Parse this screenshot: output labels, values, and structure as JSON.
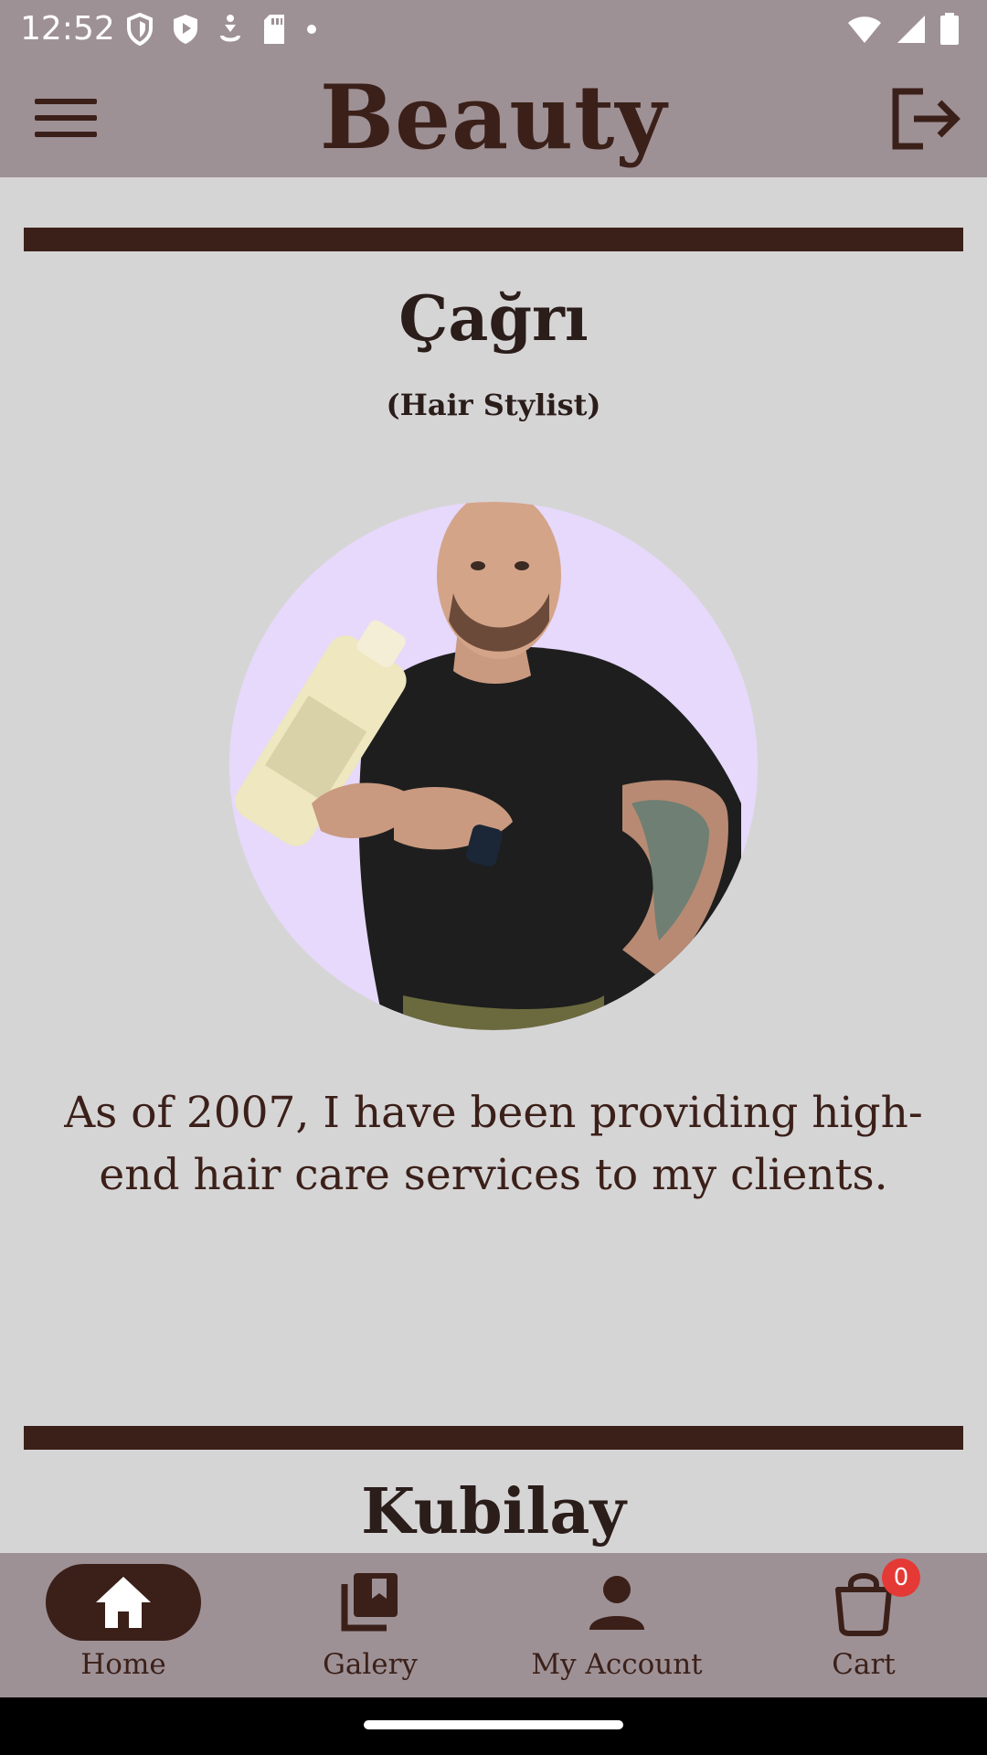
{
  "status_bar": {
    "time": "12:52"
  },
  "app_bar": {
    "title": "Beauty",
    "menu_icon": "hamburger-menu-icon",
    "logout_icon": "logout-icon"
  },
  "staff": [
    {
      "name": "Çağrı",
      "role": "(Hair Stylist)",
      "bio": "As of 2007, I have been providing high-end hair care services to my clients."
    },
    {
      "name": "Kubilay"
    }
  ],
  "bottom_nav": {
    "items": [
      {
        "label": "Home",
        "icon": "home-icon",
        "active": true
      },
      {
        "label": "Galery",
        "icon": "gallery-icon",
        "active": false
      },
      {
        "label": "My Account",
        "icon": "account-icon",
        "active": false
      },
      {
        "label": "Cart",
        "icon": "cart-icon",
        "active": false,
        "badge": "0"
      }
    ]
  },
  "colors": {
    "bar_background": "#9e9196",
    "page_background": "#d6d5d6",
    "brand_brown": "#3b2019",
    "avatar_background": "#e6d9fb",
    "badge_red": "#e53935"
  }
}
